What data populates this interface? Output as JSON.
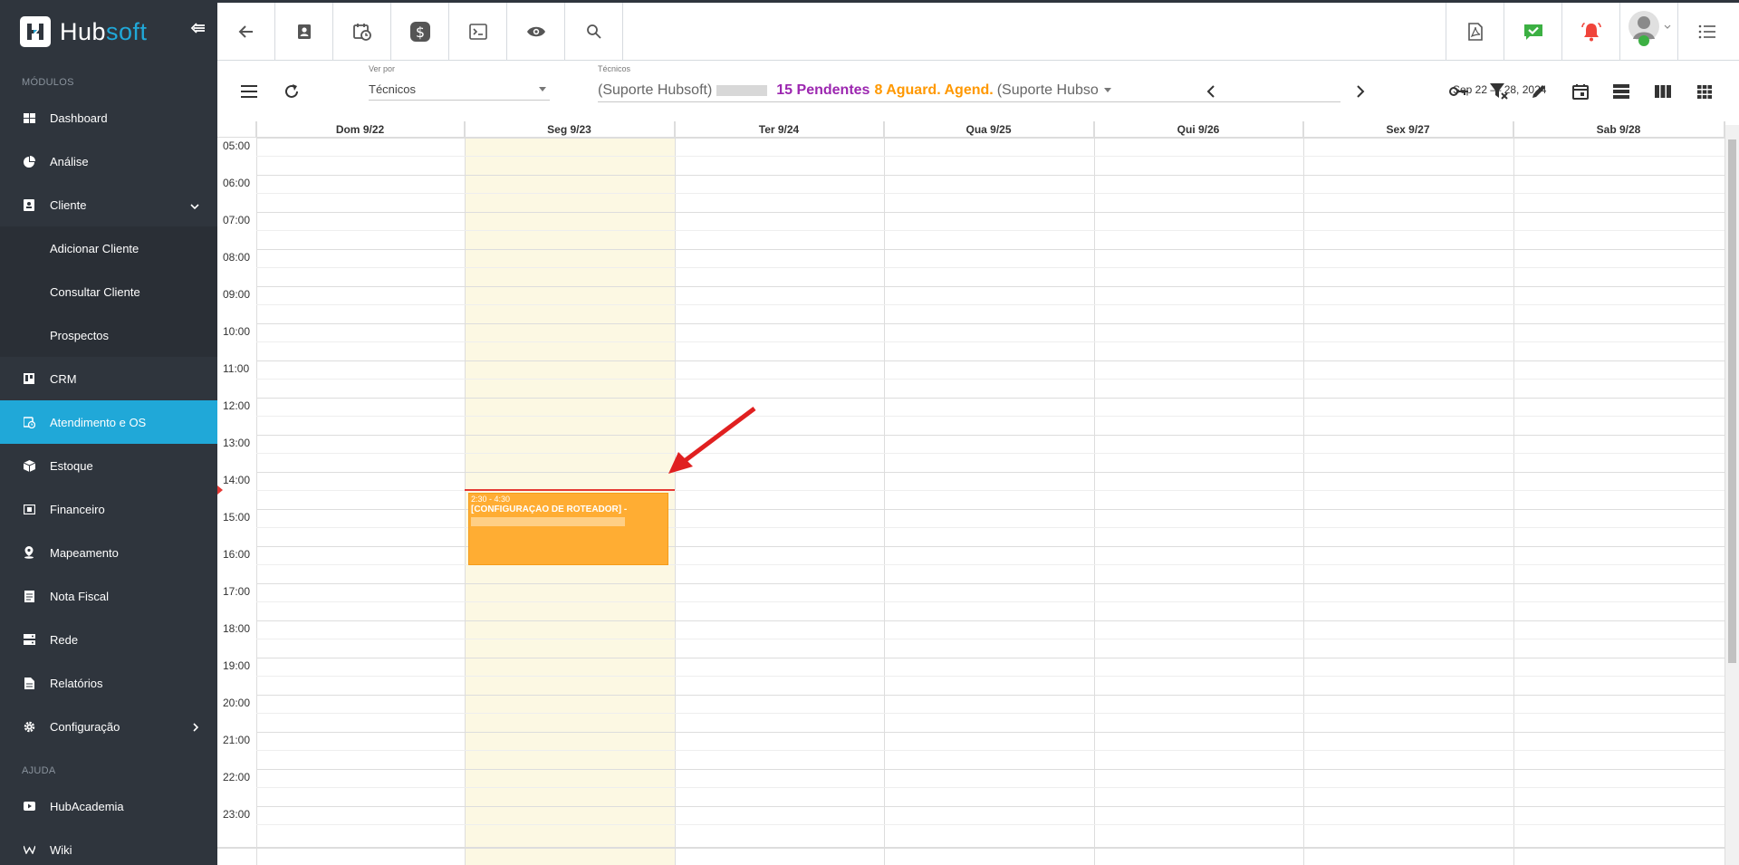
{
  "brand": {
    "name_hub": "Hub",
    "name_soft": "soft"
  },
  "sidebar": {
    "section_modules": "MÓDULOS",
    "section_help": "AJUDA",
    "items": [
      {
        "label": "Dashboard",
        "icon": "dashboard-icon"
      },
      {
        "label": "Análise",
        "icon": "pie-chart-icon"
      },
      {
        "label": "Cliente",
        "icon": "contact-card-icon"
      },
      {
        "label": "Adicionar Cliente"
      },
      {
        "label": "Consultar Cliente"
      },
      {
        "label": "Prospectos"
      },
      {
        "label": "CRM",
        "icon": "kanban-icon"
      },
      {
        "label": "Atendimento e OS",
        "icon": "calendar-clock-icon"
      },
      {
        "label": "Estoque",
        "icon": "box-icon"
      },
      {
        "label": "Financeiro",
        "icon": "money-icon"
      },
      {
        "label": "Mapeamento",
        "icon": "map-pin-icon"
      },
      {
        "label": "Nota Fiscal",
        "icon": "document-icon"
      },
      {
        "label": "Rede",
        "icon": "server-icon"
      },
      {
        "label": "Relatórios",
        "icon": "report-icon"
      },
      {
        "label": "Configuração",
        "icon": "gear-icon"
      },
      {
        "label": "HubAcademia",
        "icon": "play-icon"
      },
      {
        "label": "Wiki",
        "icon": "wiki-icon"
      }
    ]
  },
  "toolbar": {
    "view_by_label": "Ver por",
    "view_by_value": "Técnicos",
    "technicians_label": "Técnicos",
    "tech_1": "(Suporte Hubsoft)",
    "pending": "15 Pendentes",
    "waiting": "8 Aguard. Agend.",
    "tech_2": "(Suporte Hubso",
    "date_range": "Sep 22 — 28, 2024"
  },
  "calendar": {
    "days": [
      "Dom 9/22",
      "Seg 9/23",
      "Ter 9/24",
      "Qua 9/25",
      "Qui 9/26",
      "Sex 9/27",
      "Sab 9/28"
    ],
    "hours": [
      "05:00",
      "06:00",
      "07:00",
      "08:00",
      "09:00",
      "10:00",
      "11:00",
      "12:00",
      "13:00",
      "14:00",
      "15:00",
      "16:00",
      "17:00",
      "18:00",
      "19:00",
      "20:00",
      "21:00",
      "22:00",
      "23:00"
    ],
    "event": {
      "time": "2:30 - 4:30",
      "title": "[CONFIGURAÇÃO DE ROTEADOR] -"
    }
  },
  "colors": {
    "sidebar_bg": "#2f353d",
    "active": "#20a8d8",
    "today_bg": "#fcf8e3",
    "event": "#ffad33",
    "pending": "#9c27b0",
    "waiting": "#ff9800",
    "now_line": "#e53935"
  }
}
